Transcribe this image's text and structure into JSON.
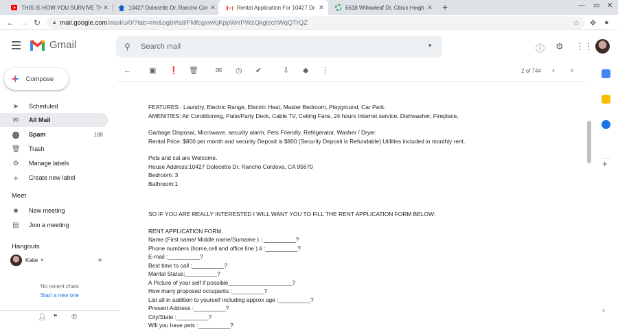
{
  "browser": {
    "tabs": [
      {
        "title": "THIS IS HOW YOU SURVIVE THE",
        "icon": "youtube-icon",
        "color": "#ff0000"
      },
      {
        "title": "10427 Dolecetto Dr, Rancho Cor",
        "icon": "house-icon",
        "color": "#1565c0"
      },
      {
        "title": "Rental Application For 10427 Dr",
        "icon": "gmail-icon",
        "color": "#ea4335",
        "active": true
      },
      {
        "title": "6618 Willowleaf Dr, Citrus Heigh",
        "icon": "recycle-icon",
        "color": "#34a853"
      }
    ],
    "url_host": "mail.google.com",
    "url_path": "/mail/u/0/?tab=rm&ogbl#all/FMfcgxwKjKppWrrPWzQkglzchWqQTrQZ"
  },
  "header": {
    "app_name": "Gmail",
    "search_placeholder": "Search mail"
  },
  "sidebar": {
    "compose_label": "Compose",
    "items": [
      {
        "label": "Scheduled",
        "icon": "scheduled-icon",
        "count": ""
      },
      {
        "label": "All Mail",
        "icon": "all-mail-icon",
        "count": "",
        "active": true
      },
      {
        "label": "Spam",
        "icon": "spam-icon",
        "count": "188",
        "bold": true
      },
      {
        "label": "Trash",
        "icon": "trash-icon",
        "count": ""
      },
      {
        "label": "Manage labels",
        "icon": "gear-icon",
        "count": ""
      },
      {
        "label": "Create new label",
        "icon": "plus-icon",
        "count": ""
      }
    ],
    "meet_title": "Meet",
    "meet_items": [
      {
        "label": "New meeting",
        "icon": "video-icon"
      },
      {
        "label": "Join a meeting",
        "icon": "keyboard-icon"
      }
    ],
    "hangouts_title": "Hangouts",
    "hangouts_user": "Katie",
    "no_recent": "No recent chats",
    "start_new": "Start a new one"
  },
  "toolbar": {
    "pager": "2 of 744"
  },
  "message": {
    "lines": [
      "FEATURES : Laundry, Electric Range, Electric Heat, Master Bedroom, Playground, Car Park.",
      "AMENITIES: Air Conditioning, Patio/Party Deck, Cable TV, Ceiling Fans, 24 hours Internet service, Dishwasher, Fireplace,",
      "",
      "Garbage Disposal, Microwave, security alarm, Pets Friendly, Refrigerator, Washer / Dryer.",
      "Rental Price: $800 per month and security Deposit is $800 (Security Deposit is Refundable) Utilities included in monthly rent.",
      "",
      "Pets and cat are Welcome.",
      "House Address:10427 Dolecetto Dr, Rancho Cordova, CA 95670",
      "Bedroom: 3",
      "Bathroom:1",
      "",
      "",
      "SO IF YOU ARE REALLY INTERESTED I WILL WANT YOU TO FILL THE RENT APPLICATION FORM BELOW:",
      "",
      "RENT APPLICATION FORM.",
      "Name (First name/ Middle name/Surname ) : __________?",
      "Phone numbers (home,cell and office line ) # :__________?",
      "E-mail :__________?",
      "Best time to call :__________?",
      "Marital Status:__________?",
      "A Picture of your self if possible____________________?",
      "How many proposed occupants :__________?",
      "List all in addition to yourself including approx age :__________?",
      "Present Address :__________?",
      "City/State :__________?",
      "Will you have pets :__________?"
    ]
  }
}
